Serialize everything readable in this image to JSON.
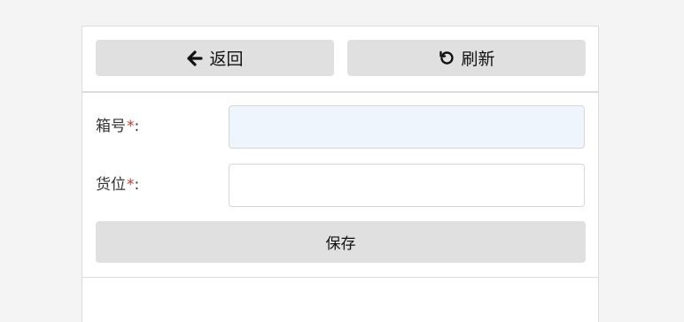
{
  "toolbar": {
    "back_label": "返回",
    "back_icon": "arrow-left-icon",
    "refresh_label": "刷新",
    "refresh_icon": "refresh-icon"
  },
  "form": {
    "box_label": "箱号",
    "box_value": "",
    "location_label": "货位",
    "location_value": "",
    "required_mark": "*",
    "colon": ":",
    "save_label": "保存"
  },
  "colors": {
    "button_bg": "#e0e0e0",
    "focused_input_bg": "#eef5fd",
    "required_color": "#c0392b"
  }
}
